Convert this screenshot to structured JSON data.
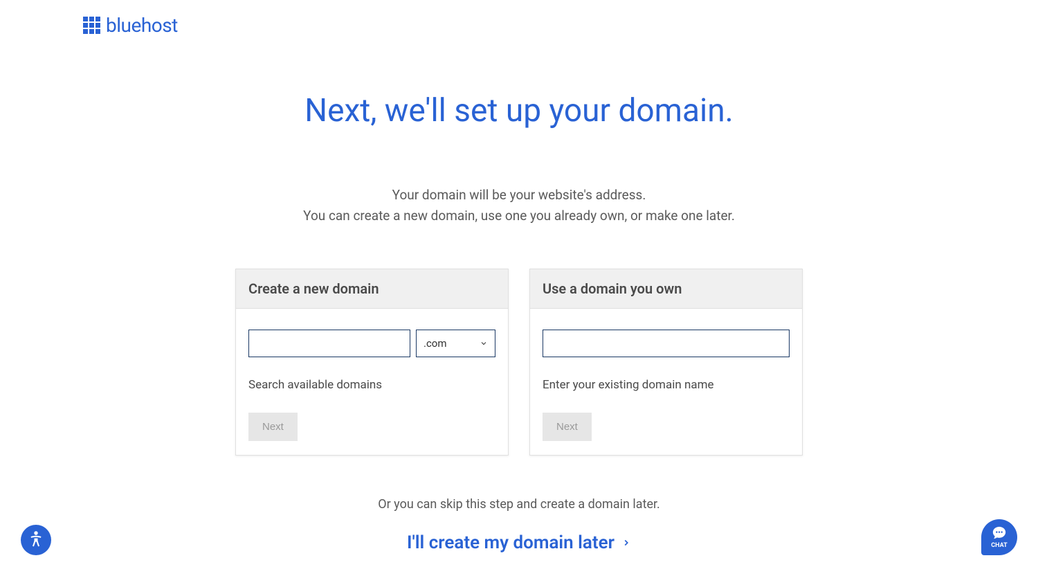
{
  "brand": {
    "name": "bluehost"
  },
  "main": {
    "title": "Next, we'll set up your domain.",
    "subtitle_line_1": "Your domain will be your website's address.",
    "subtitle_line_2": "You can create a new domain, use one you already own, or make one later."
  },
  "cards": {
    "create": {
      "title": "Create a new domain",
      "tld_selected": ".com",
      "helper": "Search available domains",
      "button": "Next"
    },
    "own": {
      "title": "Use a domain you own",
      "helper": "Enter your existing domain name",
      "button": "Next"
    }
  },
  "skip": {
    "text": "Or you can skip this step and create a domain later.",
    "link": "I'll create my domain later"
  },
  "chat": {
    "label": "CHAT"
  }
}
